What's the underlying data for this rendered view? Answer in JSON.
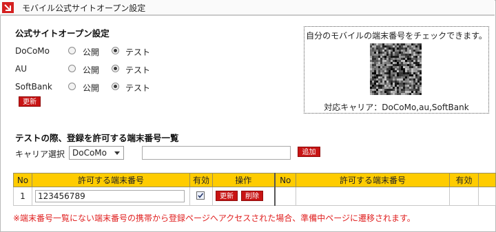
{
  "window": {
    "title": "モバイル公式サイトオープン設定"
  },
  "open_settings": {
    "heading": "公式サイトオープン設定",
    "carriers": [
      {
        "name": "DoCoMo",
        "option_public": "公開",
        "option_test": "テスト",
        "selected": "test"
      },
      {
        "name": "AU",
        "option_public": "公開",
        "option_test": "テスト",
        "selected": "test"
      },
      {
        "name": "SoftBank",
        "option_public": "公開",
        "option_test": "テスト",
        "selected": "test"
      }
    ],
    "update_button": "更新"
  },
  "qr_panel": {
    "caption": "自分のモバイルの端末番号をチェックできます。",
    "supported": "対応キャリア：DoCoMo,au,SoftBank"
  },
  "device_list": {
    "heading": "テストの際、登録を許可する端末番号一覧",
    "carrier_label": "キャリア選択",
    "carrier_selected": "DoCoMo",
    "device_input_value": "",
    "add_button": "追加",
    "columns": [
      "No",
      "許可する端末番号",
      "有効",
      "操作"
    ],
    "columns_right": [
      "No",
      "許可する端末番号",
      "有効"
    ],
    "rows": [
      {
        "no": "1",
        "device_number": "123456789",
        "enabled": true,
        "update_label": "更新",
        "delete_label": "削除"
      }
    ]
  },
  "notice": "※端末番号一覧にない端末番号の携帯から登録ページへアクセスされた場合、準備中ページに遷移されます。",
  "colors": {
    "accent": "#c81414",
    "header": "#ffcc00",
    "notice": "#e02020"
  }
}
